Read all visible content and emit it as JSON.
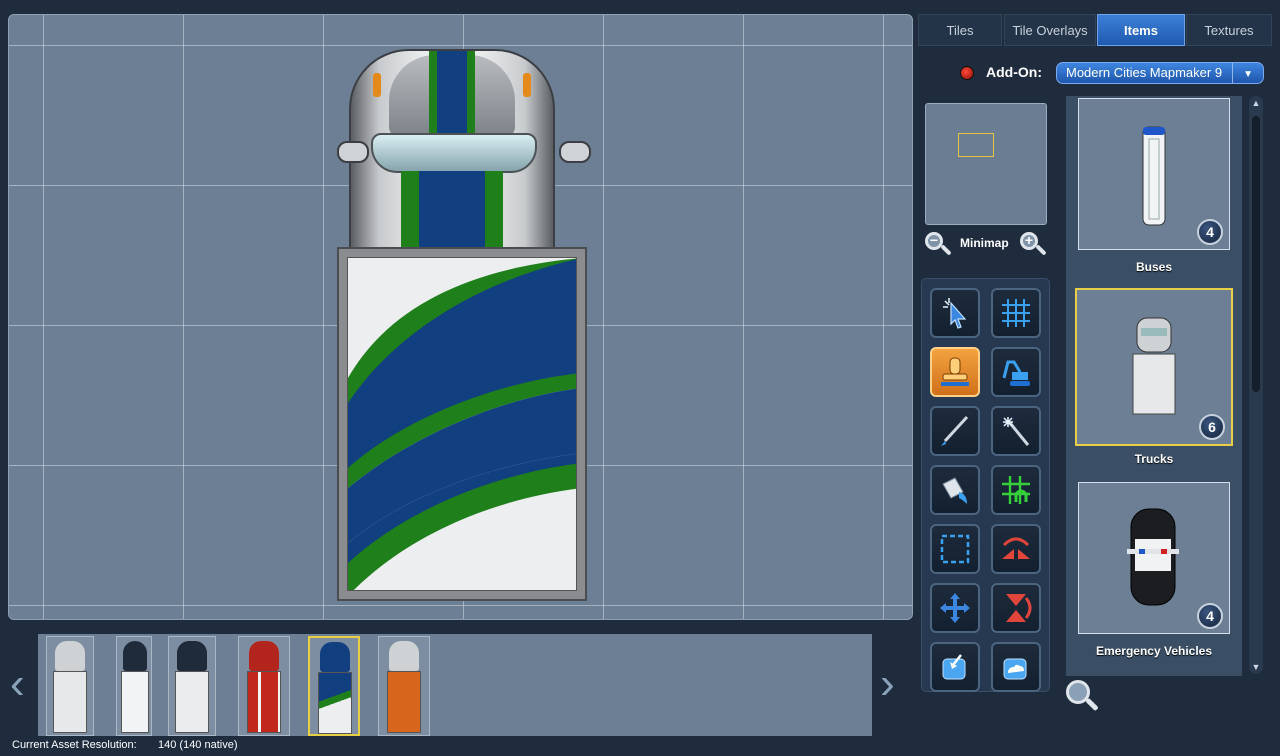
{
  "tabs": [
    {
      "label": "Tiles"
    },
    {
      "label": "Tile Overlays"
    },
    {
      "label": "Items",
      "active": true
    },
    {
      "label": "Textures"
    }
  ],
  "addon": {
    "label": "Add-On:",
    "selected": "Modern Cities Mapmaker 9"
  },
  "minimap": {
    "label": "Minimap"
  },
  "tools": [
    {
      "icon": "select-cursor-icon"
    },
    {
      "icon": "grid-icon"
    },
    {
      "icon": "stamp-icon",
      "active": true
    },
    {
      "icon": "excavator-icon"
    },
    {
      "icon": "brush-icon"
    },
    {
      "icon": "magic-wand-icon"
    },
    {
      "icon": "paint-bucket-icon"
    },
    {
      "icon": "grid-snap-icon"
    },
    {
      "icon": "selection-rect-icon"
    },
    {
      "icon": "flip-horizontal-icon"
    },
    {
      "icon": "move-icon"
    },
    {
      "icon": "flip-vertical-icon"
    },
    {
      "icon": "export-icon"
    },
    {
      "icon": "cloud-export-icon"
    }
  ],
  "items": [
    {
      "name": "Buses",
      "count": "4"
    },
    {
      "name": "Trucks",
      "count": "6",
      "selected": true
    },
    {
      "name": "Emergency Vehicles",
      "count": "4"
    }
  ],
  "variants": [
    {
      "cab": "#cfd2d4",
      "box": "#e6e8e9"
    },
    {
      "cab": "#1f2a3a",
      "box": "#f2f3f4"
    },
    {
      "cab": "#1f2a3a",
      "box": "#e9ebec"
    },
    {
      "cab": "#b3241c",
      "box": "#c2271e"
    },
    {
      "cab": "#123f7f",
      "box": "#123f7f",
      "selected": true
    },
    {
      "cab": "#cfd2d4",
      "box": "#d7661c"
    }
  ],
  "status": {
    "label": "Current Asset Resolution:",
    "value": "140 (140 native)"
  },
  "colors": {
    "accent": "#2f6fc9",
    "selection": "#e9cf45",
    "stripe_blue": "#123f7f",
    "stripe_green": "#1f7f1b"
  }
}
